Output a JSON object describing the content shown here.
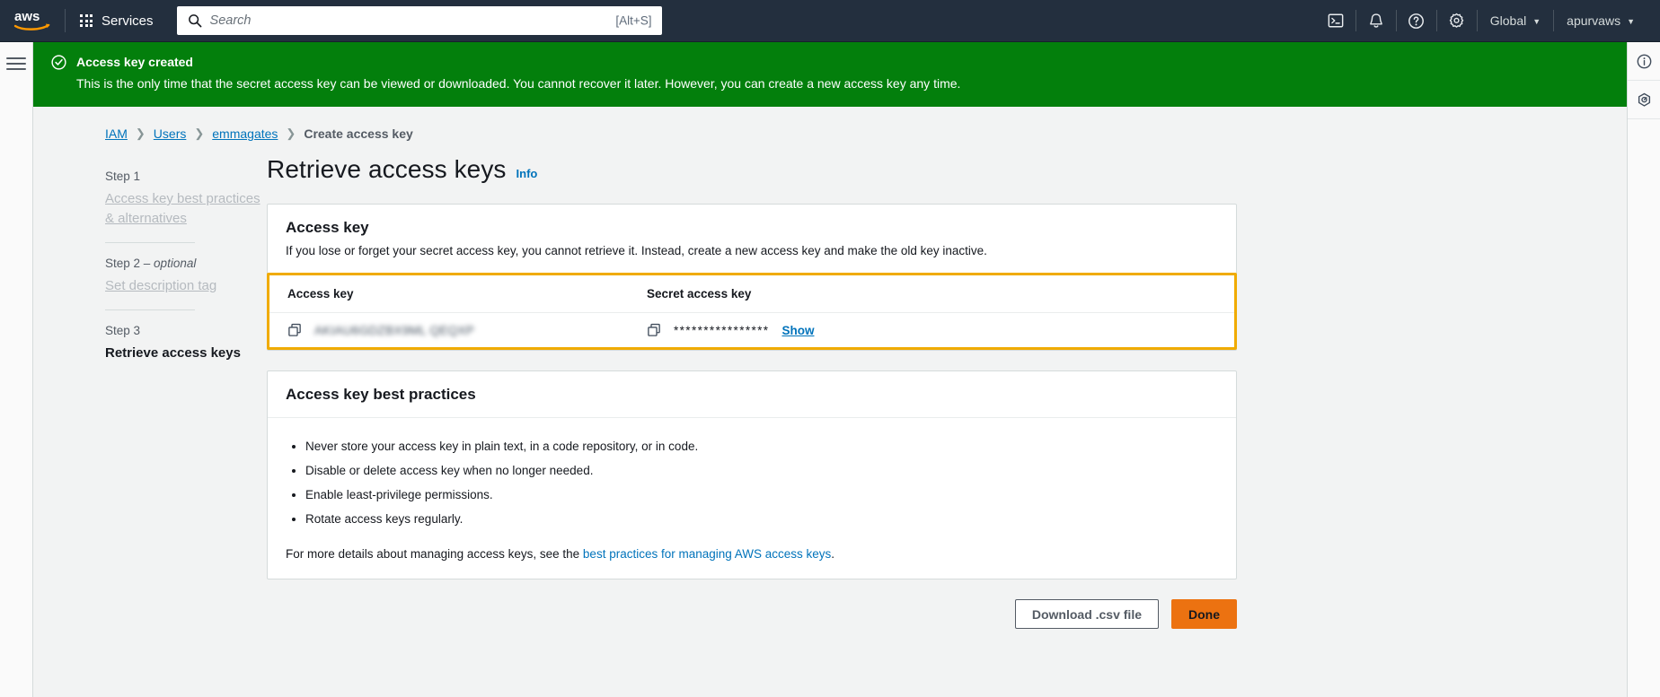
{
  "topnav": {
    "logo_alt": "aws",
    "services_label": "Services",
    "search": {
      "placeholder": "Search",
      "value": "",
      "shortcut_hint": "[Alt+S]"
    },
    "icons": [
      {
        "name": "cloudshell-icon"
      },
      {
        "name": "notifications-bell-icon"
      },
      {
        "name": "help-question-icon"
      },
      {
        "name": "settings-gear-icon"
      }
    ],
    "region_label": "Global",
    "region_caret": "▼",
    "account_label": "apurvaws",
    "account_caret": "▼"
  },
  "flash": {
    "title": "Access key created",
    "body": "This is the only time that the secret access key can be viewed or downloaded. You cannot recover it later. However, you can create a new access key any time.",
    "icon": "status-success-icon",
    "color": "#037f0c"
  },
  "breadcrumb": {
    "items": [
      {
        "label": "IAM",
        "link": true
      },
      {
        "label": "Users",
        "link": true
      },
      {
        "label": "emmagates",
        "link": true
      },
      {
        "label": "Create access key",
        "link": false
      }
    ],
    "separator": "〉"
  },
  "steps": [
    {
      "step_label": "Step 1",
      "optional": "",
      "title": "Access key best practices & alternatives",
      "active": false
    },
    {
      "step_label": "Step 2 – ",
      "optional": "optional",
      "title": "Set description tag",
      "active": false
    },
    {
      "step_label": "Step 3",
      "optional": "",
      "title": "Retrieve access keys",
      "active": true
    }
  ],
  "page": {
    "title": "Retrieve access keys",
    "info_link": "Info"
  },
  "access_key_card": {
    "title": "Access key",
    "description": "If you lose or forget your secret access key, you cannot retrieve it. Instead, create a new access key and make the old key inactive.",
    "columns": [
      "Access key",
      "Secret access key"
    ],
    "access_key_value": "AKIAU6GDZBX9ML QEQXP",
    "secret_masked": "****************",
    "show_label": "Show",
    "copy_icon": "copy-icon",
    "highlight_color": "#f0ab00"
  },
  "best_practices_card": {
    "title": "Access key best practices",
    "bullets": [
      "Never store your access key in plain text, in a code repository, or in code.",
      "Disable or delete access key when no longer needed.",
      "Enable least-privilege permissions.",
      "Rotate access keys regularly."
    ],
    "footer_prefix": "For more details about managing access keys, see the ",
    "footer_link": "best practices for managing AWS access keys",
    "footer_suffix": "."
  },
  "actions": {
    "download_label": "Download .csv file",
    "done_label": "Done",
    "primary_color": "#ec7211"
  },
  "rightrail": [
    {
      "name": "info-panel-icon"
    },
    {
      "name": "security-shield-icon"
    }
  ],
  "leftrail": {
    "menu_icon": "hamburger-menu-icon"
  }
}
